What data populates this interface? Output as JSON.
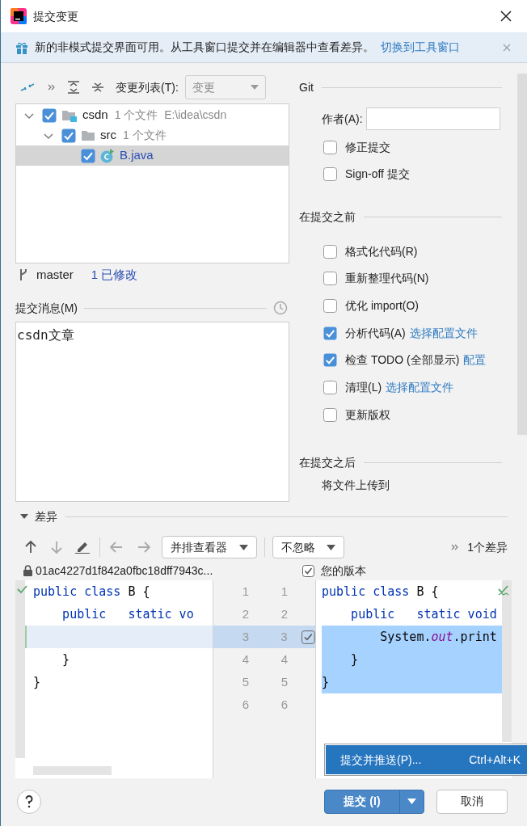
{
  "window": {
    "title": "提交变更"
  },
  "banner": {
    "text": "新的非模式提交界面可用。从工具窗口提交并在编辑器中查看差异。",
    "link": "切换到工具窗口"
  },
  "toolbar": {
    "changelist_label": "变更列表(T):",
    "changelist_value": "变更"
  },
  "tree": [
    {
      "kind": "module",
      "name": "csdn",
      "meta": "1 个文件  E:\\idea\\csdn",
      "checked": true,
      "expanded": true,
      "selected": false,
      "children": [
        {
          "kind": "folder",
          "name": "src",
          "meta": "1 个文件",
          "checked": true,
          "expanded": true,
          "selected": false,
          "children": [
            {
              "kind": "file",
              "name": "B.java",
              "checked": true,
              "selected": true
            }
          ]
        }
      ]
    }
  ],
  "branch": {
    "name": "master",
    "modified": "1 已修改"
  },
  "message": {
    "label": "提交消息(M)",
    "value": "csdn文章"
  },
  "git": {
    "title": "Git",
    "author_label": "作者(A):",
    "options": [
      {
        "label": "修正提交",
        "checked": false
      },
      {
        "label": "Sign-off 提交",
        "checked": false
      }
    ]
  },
  "before_commit": {
    "title": "在提交之前",
    "options": [
      {
        "label": "格式化代码(R)",
        "checked": false
      },
      {
        "label": "重新整理代码(N)",
        "checked": false
      },
      {
        "label": "优化 import(O)",
        "checked": false
      },
      {
        "label": "分析代码(A)",
        "link": "选择配置文件",
        "checked": true
      },
      {
        "label": "检查 TODO (全部显示)",
        "link": "配置",
        "checked": true
      },
      {
        "label": "清理(L)",
        "link": "选择配置文件",
        "checked": false
      },
      {
        "label": "更新版权",
        "checked": false
      }
    ]
  },
  "after_commit": {
    "title": "在提交之后",
    "items": [
      "将文件上传到"
    ]
  },
  "diff": {
    "title": "差异",
    "expanded": true,
    "viewer": "并排查看器",
    "ignore": "不忽略",
    "count": "1个差异",
    "left_title": "01ac4227d1f842a0fbc18dff7943c...",
    "right_title": "您的版本",
    "right_checked": true,
    "lines": [
      {
        "kind": "plain",
        "left_no": "1",
        "right_no": "1",
        "left_changed": false,
        "right_selected": false,
        "left": [
          {
            "kind": "keyword",
            "text": "public class "
          },
          {
            "kind": "plain",
            "text": "B {"
          }
        ],
        "right": [
          {
            "kind": "keyword",
            "text": "public class "
          },
          {
            "kind": "plain",
            "text": "B {"
          }
        ]
      },
      {
        "kind": "plain",
        "left_no": "2",
        "right_no": "2",
        "left_changed": false,
        "right_selected": false,
        "left": [
          {
            "kind": "keyword",
            "text": "    public   static vo"
          }
        ],
        "right": [
          {
            "kind": "keyword",
            "text": "    public   static void"
          }
        ]
      },
      {
        "kind": "change",
        "checked": true,
        "left_no": "3",
        "right_no": "3",
        "left_changed": true,
        "right_selected": true,
        "right": [
          {
            "kind": "plain",
            "text": "        System."
          },
          {
            "kind": "field",
            "text": "out"
          },
          {
            "kind": "plain",
            "text": ".print"
          }
        ]
      },
      {
        "kind": "plain",
        "left_no": "4",
        "right_no": "4",
        "left_changed": false,
        "right_selected": true,
        "left": [
          {
            "kind": "plain",
            "text": "    }"
          }
        ],
        "right": [
          {
            "kind": "plain",
            "text": "    }"
          }
        ]
      },
      {
        "kind": "plain",
        "left_no": "5",
        "right_no": "5",
        "left_changed": false,
        "right_selected": true,
        "left": [
          {
            "kind": "plain",
            "text": "}"
          }
        ],
        "right": [
          {
            "kind": "plain",
            "text": "}"
          }
        ]
      },
      {
        "kind": "plain",
        "left_no": "6",
        "right_no": "6",
        "left_changed": false,
        "right_selected": false
      }
    ]
  },
  "popup": {
    "items": [
      {
        "label": "提交并推送(P)...",
        "shortcut": "Ctrl+Alt+K",
        "selected": true
      }
    ]
  },
  "buttons": {
    "commit": "提交 (I)",
    "cancel": "取消"
  }
}
